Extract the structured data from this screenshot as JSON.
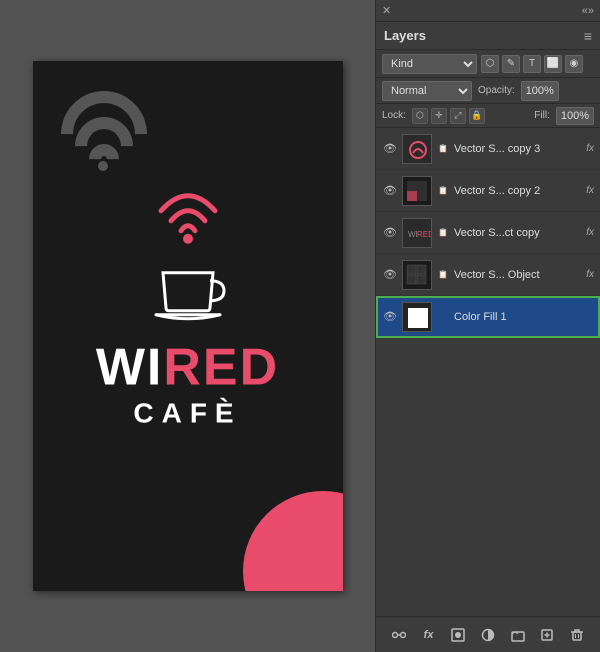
{
  "panels": {
    "topbar": {
      "close_icon": "✕",
      "expand_icon": "«»"
    },
    "layers": {
      "title": "Layers",
      "menu_icon": "≡",
      "filter": {
        "label": "Kind",
        "icons": [
          "⬡",
          "✎",
          "✛",
          "T",
          "⬜",
          "◉"
        ]
      },
      "blend": {
        "mode": "Normal",
        "opacity_label": "Opacity:",
        "opacity_value": "100%"
      },
      "lock": {
        "label": "Lock:",
        "icons": [
          "⬡",
          "✛",
          "⤢",
          "🔒"
        ],
        "fill_label": "Fill:",
        "fill_value": "100%"
      },
      "items": [
        {
          "name": "Vector S... copy 3",
          "visible": true,
          "has_fx": true,
          "selected": false,
          "thumb_type": "vector_red"
        },
        {
          "name": "Vector S... copy 2",
          "visible": true,
          "has_fx": true,
          "selected": false,
          "thumb_type": "vector_mixed"
        },
        {
          "name": "Vector S...ct copy",
          "visible": true,
          "has_fx": true,
          "selected": false,
          "thumb_type": "vector_dark"
        },
        {
          "name": "Vector S... Object",
          "visible": true,
          "has_fx": true,
          "selected": false,
          "thumb_type": "vector_dark2"
        },
        {
          "name": "Color Fill 1",
          "visible": true,
          "has_fx": false,
          "selected": true,
          "thumb_type": "color_fill"
        }
      ],
      "toolbar": {
        "buttons": [
          "GD",
          "fx",
          "◻",
          "◉",
          "📁",
          "⊕",
          "🗑"
        ]
      }
    }
  },
  "canvas": {
    "artwork": {
      "title": "WIRED CAFÉ",
      "wired_white": "WI",
      "wired_red": "RED",
      "cafe": "CAFÈ"
    }
  }
}
